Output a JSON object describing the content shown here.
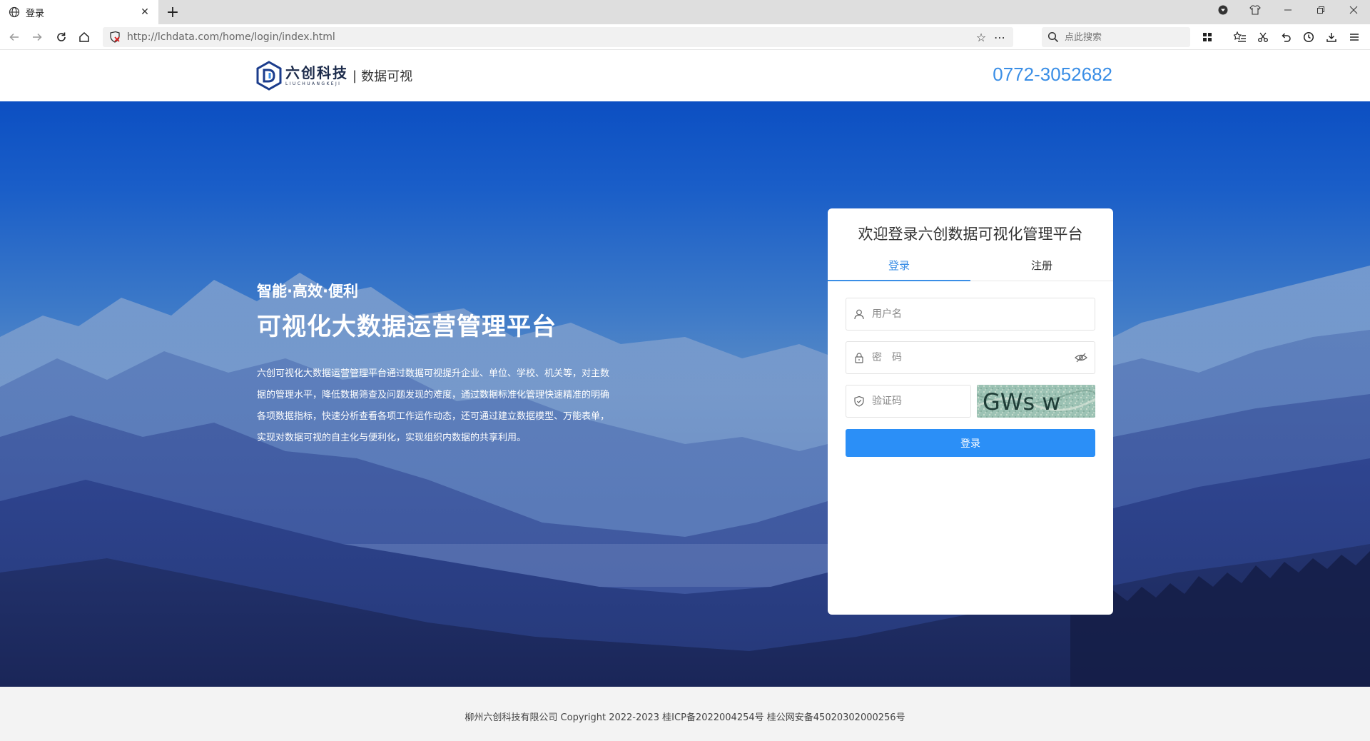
{
  "browser": {
    "tab_title": "登录",
    "url": "http://lchdata.com/home/login/index.html",
    "search_placeholder": "点此搜索"
  },
  "header": {
    "logo_cn": "六创科技",
    "logo_en": "LIUCHUANGKEJI",
    "logo_separator": "|",
    "logo_sub": "数据可视",
    "phone": "0772-3052682"
  },
  "hero": {
    "slogan": "智能·高效·便利",
    "title": "可视化大数据运营管理平台",
    "description": "六创可视化大数据运营管理平台通过数据可视提升企业、单位、学校、机关等，对主数据的管理水平，降低数据筛查及问题发现的难度，通过数据标准化管理快速精准的明确各项数据指标，快速分析查看各项工作运作动态，还可通过建立数据模型、万能表单，实现对数据可视的自主化与便利化，实现组织内数据的共享利用。"
  },
  "login": {
    "title": "欢迎登录六创数据可视化管理平台",
    "tabs": [
      {
        "label": "登录",
        "active": true
      },
      {
        "label": "注册",
        "active": false
      }
    ],
    "username_placeholder": "用户名",
    "password_placeholder": "密　码",
    "captcha_placeholder": "验证码",
    "captcha_text": "GWs w",
    "submit_label": "登录"
  },
  "footer": {
    "text": "柳州六创科技有限公司 Copyright 2022-2023 桂ICP备2022004254号 桂公网安备45020302000256号"
  },
  "colors": {
    "accent": "#3a8ee6",
    "button": "#2b8ff7",
    "footer_bg": "#f3f3f3"
  }
}
